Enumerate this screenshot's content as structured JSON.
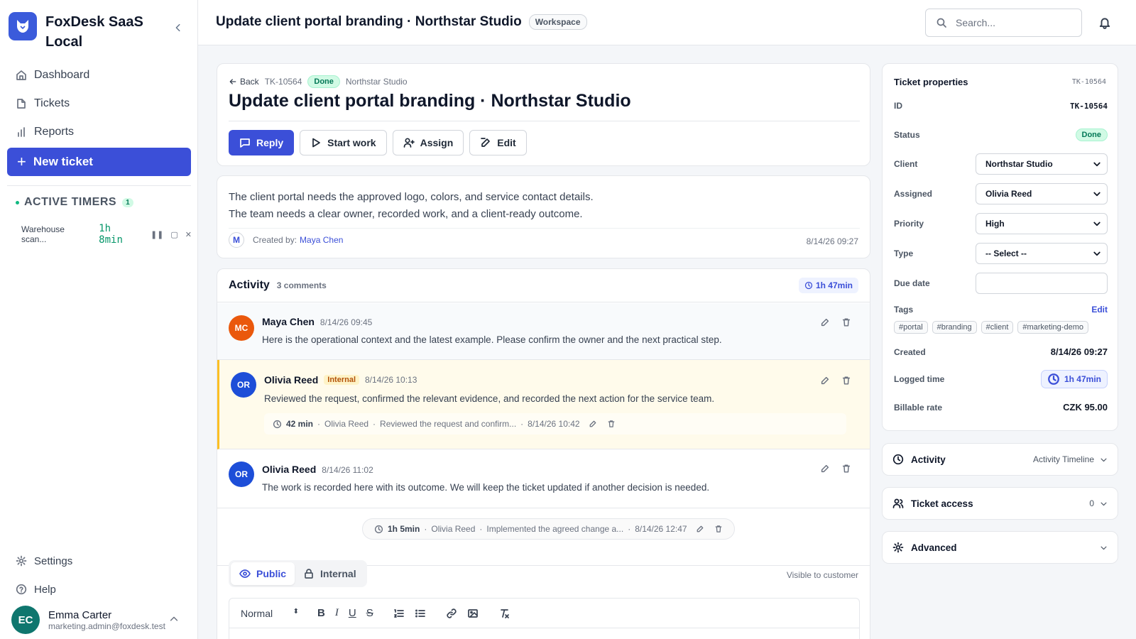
{
  "app": {
    "name": "FoxDesk SaaS Local"
  },
  "nav": [
    {
      "label": "Dashboard",
      "icon": "home-icon"
    },
    {
      "label": "Tickets",
      "icon": "file-icon"
    },
    {
      "label": "Reports",
      "icon": "bar-chart-icon"
    }
  ],
  "new_ticket": "New ticket",
  "timers": {
    "title": "ACTIVE TIMERS",
    "count": "1",
    "item": {
      "name": "Warehouse scan...",
      "time": "1h 8min"
    }
  },
  "bottom_nav": [
    {
      "label": "Settings"
    },
    {
      "label": "Help"
    }
  ],
  "user": {
    "initials": "EC",
    "name": "Emma Carter",
    "email": "marketing.admin@foxdesk.test"
  },
  "header": {
    "title": "Update client portal branding · Northstar Studio",
    "badge": "Workspace",
    "search_placeholder": "Search..."
  },
  "ticket": {
    "back": "Back",
    "id": "TK-10564",
    "status": "Done",
    "client": "Northstar Studio",
    "title": "Update client portal branding · Northstar Studio",
    "actions": {
      "reply": "Reply",
      "start": "Start work",
      "assign": "Assign",
      "edit": "Edit"
    },
    "description": [
      "The client portal needs the approved logo, colors, and service contact details.",
      "The team needs a clear owner, recorded work, and a client-ready outcome."
    ],
    "creator_initial": "M",
    "created_by_label": "Created by:",
    "created_by": "Maya Chen",
    "created_at": "8/14/26 09:27"
  },
  "activity": {
    "title": "Activity",
    "subtitle": "3 comments",
    "total": "1h 47min",
    "comments": [
      {
        "initials": "MC",
        "author": "Maya Chen",
        "date": "8/14/26 09:45",
        "text": "Here is the operational context and the latest example. Please confirm the owner and the next practical step.",
        "color": "#ea580c"
      },
      {
        "initials": "OR",
        "author": "Olivia Reed",
        "badge": "Internal",
        "date": "8/14/26 10:13",
        "text": "Reviewed the request, confirmed the relevant evidence, and recorded the next action for the service team.",
        "color": "#1d4ed8",
        "work": {
          "duration": "42 min",
          "user": "Olivia Reed",
          "note": "Reviewed the request and confirm...",
          "date": "8/14/26 10:42"
        }
      },
      {
        "initials": "OR",
        "author": "Olivia Reed",
        "date": "8/14/26 11:02",
        "text": "The work is recorded here with its outcome. We will keep the ticket updated if another decision is needed.",
        "color": "#1d4ed8",
        "work": {
          "duration": "1h 5min",
          "user": "Olivia Reed",
          "note": "Implemented the agreed change a...",
          "date": "8/14/26 12:47"
        }
      }
    ]
  },
  "composer": {
    "tab_public": "Public",
    "tab_internal": "Internal",
    "visibility": "Visible to customer",
    "format": "Normal"
  },
  "properties": {
    "title": "Ticket properties",
    "id_label": "ID",
    "id": "TK-10564",
    "status_label": "Status",
    "status": "Done",
    "client_label": "Client",
    "client": "Northstar Studio",
    "assigned_label": "Assigned",
    "assigned": "Olivia Reed",
    "priority_label": "Priority",
    "priority": "High",
    "type_label": "Type",
    "type": "-- Select --",
    "due_label": "Due date",
    "due": "",
    "tags_label": "Tags",
    "tags_edit": "Edit",
    "tags": [
      "#portal",
      "#branding",
      "#client",
      "#marketing-demo"
    ],
    "created_label": "Created",
    "created": "8/14/26 09:27",
    "logged_label": "Logged time",
    "logged": "1h 47min",
    "rate_label": "Billable rate",
    "rate": "CZK 95.00"
  },
  "panels": {
    "activity": "Activity",
    "activity_view": "Activity Timeline",
    "access": "Ticket access",
    "access_count": "0",
    "advanced": "Advanced"
  }
}
